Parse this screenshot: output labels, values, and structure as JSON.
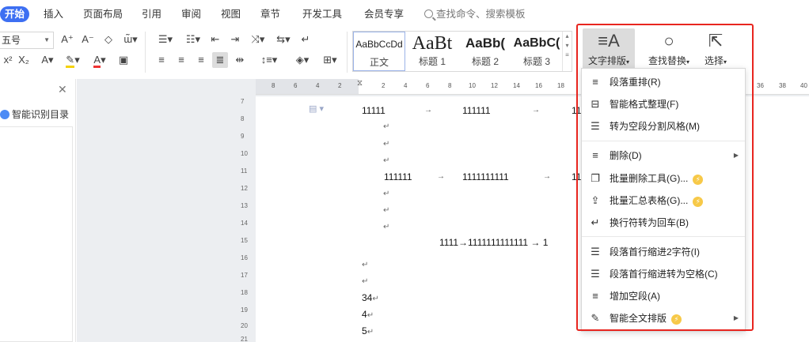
{
  "tabs": [
    {
      "label": "开始",
      "active": true
    },
    {
      "label": "插入"
    },
    {
      "label": "页面布局"
    },
    {
      "label": "引用"
    },
    {
      "label": "审阅"
    },
    {
      "label": "视图"
    },
    {
      "label": "章节"
    },
    {
      "label": "开发工具"
    },
    {
      "label": "会员专享"
    }
  ],
  "search": {
    "label": "查找命令、搜索模板",
    "icon": "search-icon"
  },
  "ribbon": {
    "font_size_value": "五号",
    "styles": [
      {
        "sample": "AaBbCcDd",
        "name": "正文"
      },
      {
        "sample": "AaBt",
        "name": "标题 1"
      },
      {
        "sample": "AaBb(",
        "name": "标题 2"
      },
      {
        "sample": "AaBbC(",
        "name": "标题 3"
      }
    ],
    "text_layout_label": "文字排版",
    "find_replace_label": "查找替换",
    "select_label": "选择"
  },
  "nav_panel": {
    "title": "智能识别目录"
  },
  "ruler": {
    "h_ticks": [
      "8",
      "6",
      "4",
      "2",
      "2",
      "4",
      "6",
      "8",
      "10",
      "12",
      "14",
      "16",
      "18",
      "36",
      "38",
      "40"
    ],
    "v_ticks": [
      "7",
      "8",
      "9",
      "10",
      "11",
      "12",
      "13",
      "14",
      "15",
      "16",
      "17",
      "18",
      "19",
      "20",
      "21"
    ]
  },
  "document": {
    "rows": [
      {
        "cells": [
          "11111",
          "111111",
          "11"
        ]
      },
      {
        "cells": [
          "111111",
          "1111111111",
          "11"
        ]
      },
      {
        "text": "1111→1111111111111 → 1"
      },
      {
        "text": "34"
      },
      {
        "text": "4"
      },
      {
        "text": "5"
      }
    ],
    "para_mark": "↵"
  },
  "menu": {
    "items": [
      {
        "icon": "paragraph-relayout-icon",
        "label": "段落重排(R)"
      },
      {
        "icon": "smart-format-icon",
        "label": "智能格式整理(F)"
      },
      {
        "icon": "split-style-icon",
        "label": "转为空段分割风格(M)"
      },
      {
        "icon": "delete-icon",
        "label": "删除(D)",
        "submenu": true
      },
      {
        "icon": "batch-delete-icon",
        "label": "批量删除工具(G)...",
        "premium": true
      },
      {
        "icon": "batch-summary-icon",
        "label": "批量汇总表格(G)...",
        "premium": true
      },
      {
        "icon": "line-break-icon",
        "label": "换行符转为回车(B)"
      },
      {
        "icon": "indent-icon",
        "label": "段落首行缩进2字符(I)"
      },
      {
        "icon": "indent-space-icon",
        "label": "段落首行缩进转为空格(C)"
      },
      {
        "icon": "add-empty-paragraph-icon",
        "label": "增加空段(A)"
      },
      {
        "icon": "smart-full-layout-icon",
        "label": "智能全文排版",
        "premium": true,
        "submenu": true
      }
    ]
  },
  "colors": {
    "accent": "#3d6ff2",
    "highlight_border": "#e8251f",
    "premium_badge": "#f7c948"
  }
}
